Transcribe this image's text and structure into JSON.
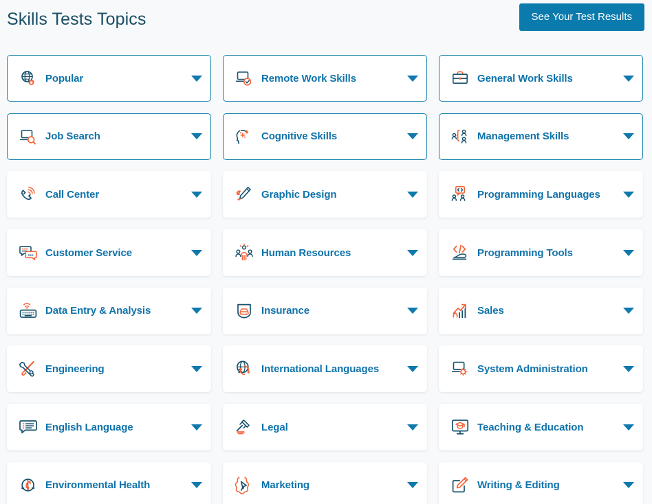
{
  "header": {
    "title": "Skills Tests Topics",
    "results_button": "See Your Test Results"
  },
  "colors": {
    "page_background": "#f7f9fb",
    "title_text": "#1b4f63",
    "accent_blue": "#0b7aad",
    "link_blue": "#1073ab",
    "card_border_highlight": "#1781ab",
    "icon_blue": "#17526e",
    "icon_orange": "#f4663a",
    "card_background": "#ffffff",
    "button_text": "#ffffff"
  },
  "grid": {
    "columns": 3,
    "caret_icon": "chevron-down-icon",
    "cards": [
      {
        "label": "Popular",
        "icon": "globe-cursor-icon",
        "highlight": true
      },
      {
        "label": "Remote Work Skills",
        "icon": "laptop-check-icon",
        "highlight": true
      },
      {
        "label": "General Work Skills",
        "icon": "briefcase-icon",
        "highlight": true
      },
      {
        "label": "Job Search",
        "icon": "laptop-search-icon",
        "highlight": true
      },
      {
        "label": "Cognitive Skills",
        "icon": "head-brain-icon",
        "highlight": true
      },
      {
        "label": "Management Skills",
        "icon": "org-chart-people-icon",
        "highlight": true
      },
      {
        "label": "Call Center",
        "icon": "phone-signal-icon",
        "highlight": false
      },
      {
        "label": "Graphic Design",
        "icon": "pen-scribble-icon",
        "highlight": false
      },
      {
        "label": "Programming Languages",
        "icon": "people-code-bubble-icon",
        "highlight": false
      },
      {
        "label": "Customer Service",
        "icon": "chat-bubbles-icon",
        "highlight": false
      },
      {
        "label": "Human Resources",
        "icon": "people-group-icon",
        "highlight": false
      },
      {
        "label": "Programming Tools",
        "icon": "code-tool-icon",
        "highlight": false
      },
      {
        "label": "Data Entry & Analysis",
        "icon": "keyboard-wifi-icon",
        "highlight": false
      },
      {
        "label": "Insurance",
        "icon": "car-shield-icon",
        "highlight": false
      },
      {
        "label": "Sales",
        "icon": "growth-chart-icon",
        "highlight": false
      },
      {
        "label": "Engineering",
        "icon": "wrench-screwdriver-icon",
        "highlight": false
      },
      {
        "label": "International Languages",
        "icon": "globe-translate-icon",
        "highlight": false
      },
      {
        "label": "System Administration",
        "icon": "laptop-gear-icon",
        "highlight": false
      },
      {
        "label": "English Language",
        "icon": "chat-list-icon",
        "highlight": false
      },
      {
        "label": "Legal",
        "icon": "gavel-icon",
        "highlight": false
      },
      {
        "label": "Teaching & Education",
        "icon": "monitor-graduation-icon",
        "highlight": false
      },
      {
        "label": "Environmental Health",
        "icon": "leaf-recycle-icon",
        "highlight": false
      },
      {
        "label": "Marketing",
        "icon": "megaphone-icon",
        "highlight": false
      },
      {
        "label": "Writing & Editing",
        "icon": "note-pencil-icon",
        "highlight": false
      }
    ]
  }
}
